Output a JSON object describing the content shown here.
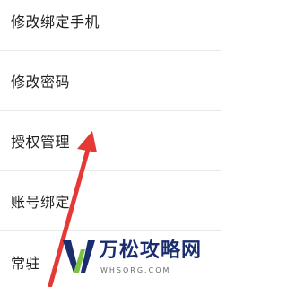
{
  "settings": {
    "items": [
      {
        "label": "修改绑定手机"
      },
      {
        "label": "修改密码"
      },
      {
        "label": "授权管理"
      },
      {
        "label": "账号绑定"
      },
      {
        "label": "常驻"
      }
    ]
  },
  "watermark": {
    "title": "万松攻略网",
    "subtitle": "WHSORG.COM"
  },
  "colors": {
    "arrow": "#e53935",
    "divider": "#e9e9e9",
    "watermark_blue": "#1a2d6e",
    "watermark_green": "#7cc242"
  }
}
